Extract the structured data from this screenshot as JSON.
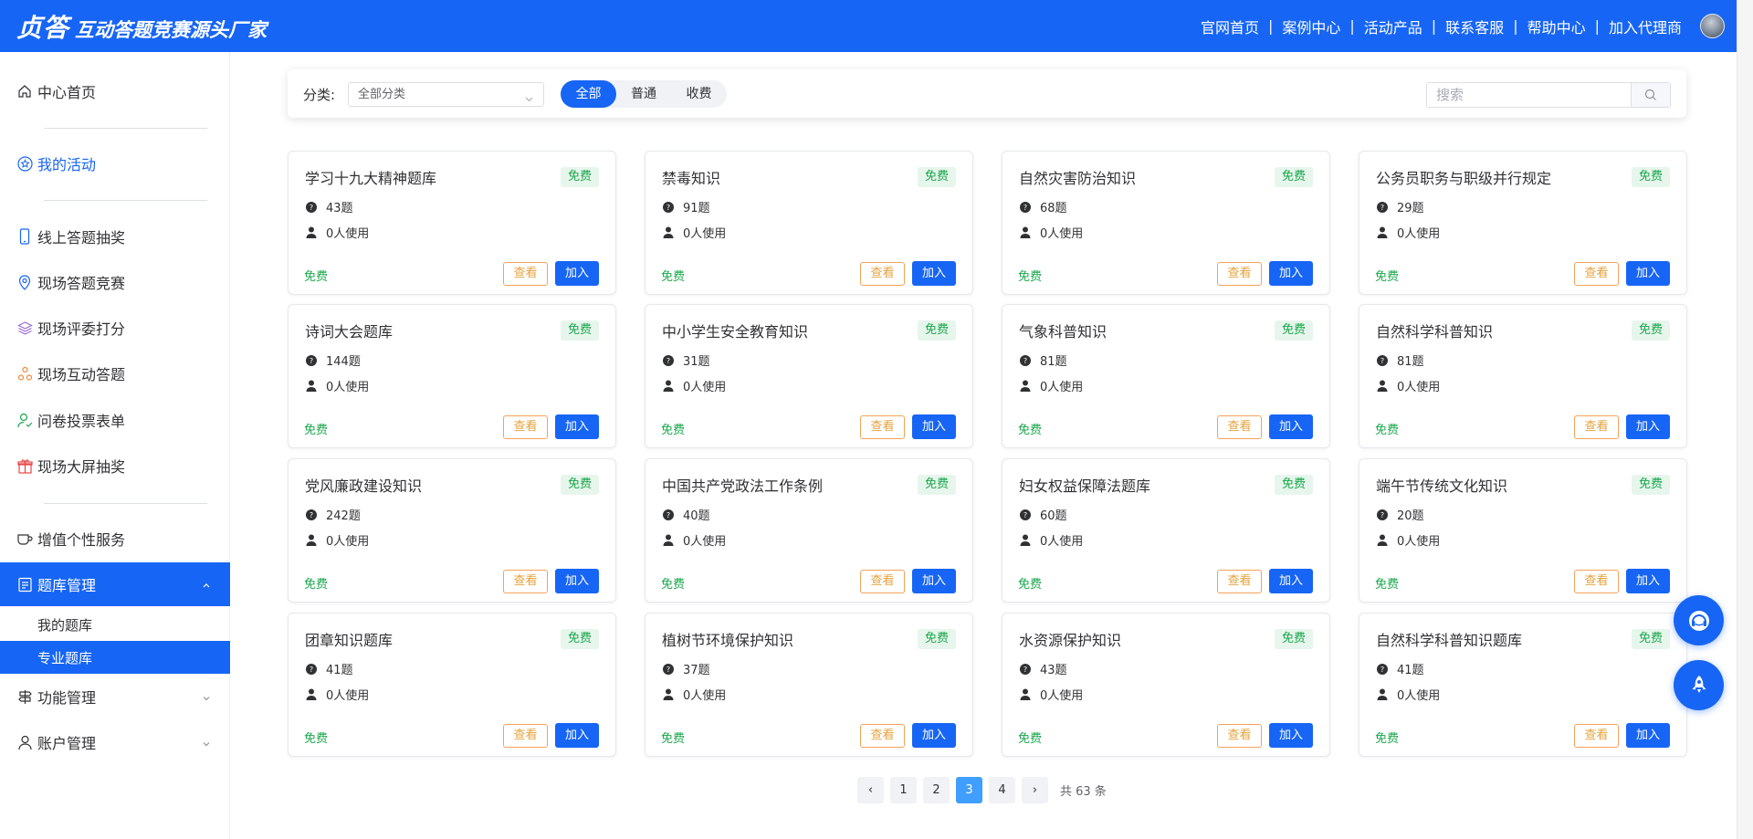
{
  "header": {
    "brand": "贞答",
    "slogan": "互动答题竞赛源头厂家",
    "nav": [
      "官网首页",
      "案例中心",
      "活动产品",
      "联系客服",
      "帮助中心",
      "加入代理商"
    ],
    "separator": "|"
  },
  "sidebar": {
    "items": [
      {
        "label": "中心首页",
        "icon": "home-icon"
      },
      {
        "label": "我的活动",
        "icon": "star-icon"
      },
      {
        "label": "线上答题抽奖",
        "icon": "mobile-icon"
      },
      {
        "label": "现场答题竞赛",
        "icon": "location-icon"
      },
      {
        "label": "现场评委打分",
        "icon": "layers-icon"
      },
      {
        "label": "现场互动答题",
        "icon": "nodes-icon"
      },
      {
        "label": "问卷投票表单",
        "icon": "user-check-icon"
      },
      {
        "label": "现场大屏抽奖",
        "icon": "gift-icon"
      },
      {
        "label": "增值个性服务",
        "icon": "cup-icon"
      },
      {
        "label": "题库管理",
        "icon": "document-icon"
      },
      {
        "label": "我的题库"
      },
      {
        "label": "专业题库"
      },
      {
        "label": "功能管理",
        "icon": "signpost-icon"
      },
      {
        "label": "账户管理",
        "icon": "person-icon"
      }
    ]
  },
  "filter": {
    "label": "分类:",
    "category_value": "全部分类",
    "tabs": [
      "全部",
      "普通",
      "收费"
    ],
    "active_tab": "全部",
    "search_placeholder": "搜索"
  },
  "cards": [
    {
      "title": "学习十九大精神题库",
      "badge": "免费",
      "questions": "43题",
      "users": "0人使用",
      "price": "免费",
      "view": "查看",
      "join": "加入"
    },
    {
      "title": "禁毒知识",
      "badge": "免费",
      "questions": "91题",
      "users": "0人使用",
      "price": "免费",
      "view": "查看",
      "join": "加入"
    },
    {
      "title": "自然灾害防治知识",
      "badge": "免费",
      "questions": "68题",
      "users": "0人使用",
      "price": "免费",
      "view": "查看",
      "join": "加入"
    },
    {
      "title": "公务员职务与职级并行规定",
      "badge": "免费",
      "questions": "29题",
      "users": "0人使用",
      "price": "免费",
      "view": "查看",
      "join": "加入"
    },
    {
      "title": "诗词大会题库",
      "badge": "免费",
      "questions": "144题",
      "users": "0人使用",
      "price": "免费",
      "view": "查看",
      "join": "加入"
    },
    {
      "title": "中小学生安全教育知识",
      "badge": "免费",
      "questions": "31题",
      "users": "0人使用",
      "price": "免费",
      "view": "查看",
      "join": "加入"
    },
    {
      "title": "气象科普知识",
      "badge": "免费",
      "questions": "81题",
      "users": "0人使用",
      "price": "免费",
      "view": "查看",
      "join": "加入"
    },
    {
      "title": "自然科学科普知识",
      "badge": "免费",
      "questions": "81题",
      "users": "0人使用",
      "price": "免费",
      "view": "查看",
      "join": "加入"
    },
    {
      "title": "党风廉政建设知识",
      "badge": "免费",
      "questions": "242题",
      "users": "0人使用",
      "price": "免费",
      "view": "查看",
      "join": "加入"
    },
    {
      "title": "中国共产党政法工作条例",
      "badge": "免费",
      "questions": "40题",
      "users": "0人使用",
      "price": "免费",
      "view": "查看",
      "join": "加入"
    },
    {
      "title": "妇女权益保障法题库",
      "badge": "免费",
      "questions": "60题",
      "users": "0人使用",
      "price": "免费",
      "view": "查看",
      "join": "加入"
    },
    {
      "title": "端午节传统文化知识",
      "badge": "免费",
      "questions": "20题",
      "users": "0人使用",
      "price": "免费",
      "view": "查看",
      "join": "加入"
    },
    {
      "title": "团章知识题库",
      "badge": "免费",
      "questions": "41题",
      "users": "0人使用",
      "price": "免费",
      "view": "查看",
      "join": "加入"
    },
    {
      "title": "植树节环境保护知识",
      "badge": "免费",
      "questions": "37题",
      "users": "0人使用",
      "price": "免费",
      "view": "查看",
      "join": "加入"
    },
    {
      "title": "水资源保护知识",
      "badge": "免费",
      "questions": "43题",
      "users": "0人使用",
      "price": "免费",
      "view": "查看",
      "join": "加入"
    },
    {
      "title": "自然科学科普知识题库",
      "badge": "免费",
      "questions": "41题",
      "users": "0人使用",
      "price": "免费",
      "view": "查看",
      "join": "加入"
    }
  ],
  "pagination": {
    "prev": "‹",
    "next": "›",
    "pages": [
      "1",
      "2",
      "3",
      "4"
    ],
    "current": "3",
    "total": "共 63 条"
  },
  "colors": {
    "primary": "#1765f4",
    "free_green": "#19a64b",
    "view_orange": "#e6a23c",
    "page_active": "#409eff"
  }
}
